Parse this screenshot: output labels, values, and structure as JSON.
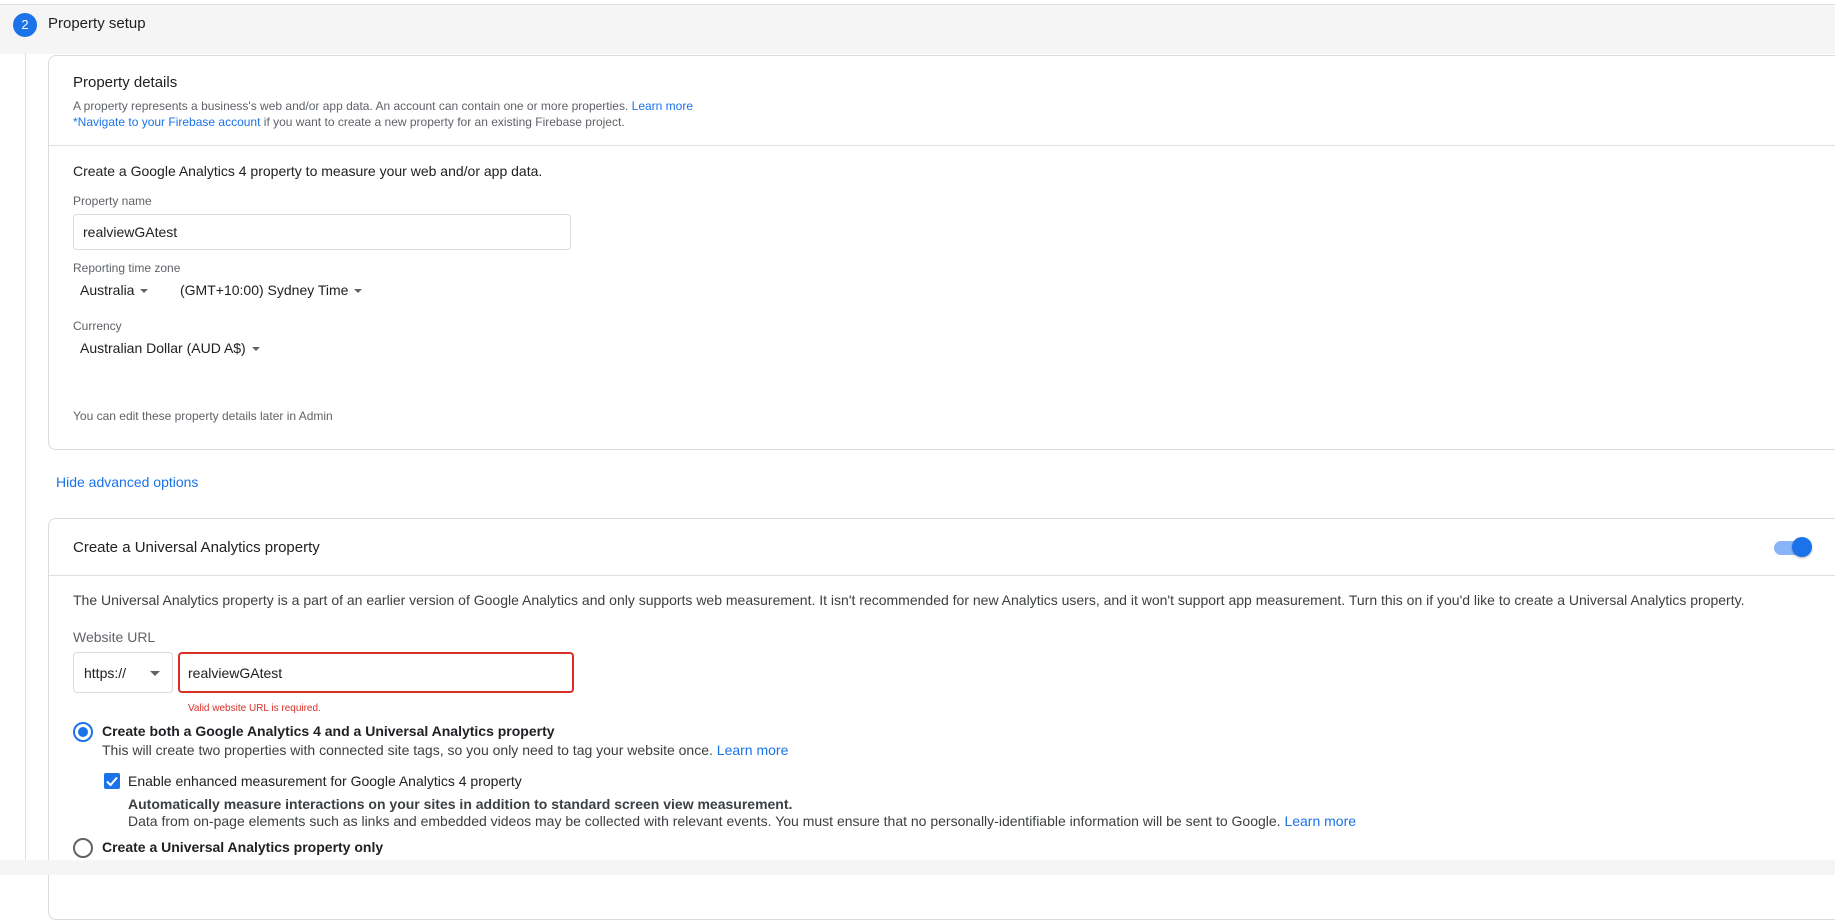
{
  "step": {
    "number": "2",
    "title": "Property setup"
  },
  "details": {
    "title": "Property details",
    "desc_line1": "A property represents a business's web and/or app data. An account can contain one or more properties.",
    "desc_line1_link": "Learn more",
    "desc_line2_link": "*Navigate to your Firebase account",
    "desc_line2": "if you want to create a new property for an existing Firebase project.",
    "lead": "Create a Google Analytics 4 property to measure your web and/or app data.",
    "property_name_label": "Property name",
    "property_name_value": "realviewGAtest",
    "timezone_label": "Reporting time zone",
    "country": "Australia",
    "timezone": "(GMT+10:00) Sydney Time",
    "currency_label": "Currency",
    "currency": "Australian Dollar (AUD A$)",
    "hint": "You can edit these property details later in Admin"
  },
  "advanced_link": "Hide advanced options",
  "ua": {
    "title": "Create a Universal Analytics property",
    "toggle_on": true,
    "desc": "The Universal Analytics property is a part of an earlier version of Google Analytics and only supports web measurement. It isn't recommended for new Analytics users, and it won't support app measurement. Turn this on if you'd like to create a Universal Analytics property.",
    "url_label": "Website URL",
    "protocol": "https://",
    "url_value": "realviewGAtest",
    "error": "Valid website URL is required.",
    "option_both_label": "Create both a Google Analytics 4 and a Universal Analytics property",
    "option_both_desc": "This will create two properties with connected site tags, so you only need to tag your website once.",
    "option_both_link": "Learn more",
    "enhanced_label": "Enable enhanced measurement for Google Analytics 4 property",
    "enhanced_strong": "Automatically measure interactions on your sites in addition to standard screen view measurement.",
    "enhanced_desc": "Data from on-page elements such as links and embedded videos may be collected with relevant events. You must ensure that no personally-identifiable information will be sent to Google.",
    "enhanced_link": "Learn more",
    "option_ua_only_label": "Create a Universal Analytics property only"
  }
}
